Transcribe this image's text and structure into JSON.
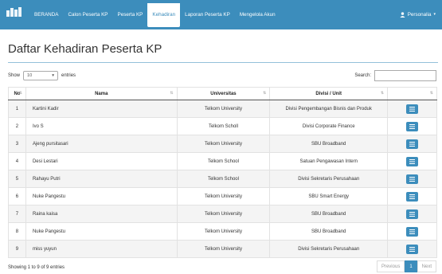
{
  "navbar": {
    "brand_icon": "brand-logo-icon",
    "items": [
      {
        "label": "BERANDA"
      },
      {
        "label": "Calon Peserta KP"
      },
      {
        "label": "Peserta KP"
      },
      {
        "label": "Kehadiran"
      },
      {
        "label": "Laporan Peserta KP"
      },
      {
        "label": "Mengelola Akun"
      }
    ],
    "active_index": 3,
    "user_label": "Personalia",
    "user_icon": "user-icon",
    "colors": {
      "bar": "#3c8dbc",
      "text": "#ffffff"
    }
  },
  "page": {
    "title": "Daftar Kehadiran Peserta KP"
  },
  "controls": {
    "show_label": "Show",
    "length_value": "10",
    "entries_label": "entries",
    "search_label": "Search:",
    "search_value": ""
  },
  "table": {
    "headers": [
      "No",
      "Nama",
      "Universitas",
      "Divisi / Unit",
      ""
    ],
    "rows": [
      {
        "no": "1",
        "nama": "Kartini Kadir",
        "universitas": "Telkom University",
        "divisi": "Divisi Pengembangan Bisnis dan Produk"
      },
      {
        "no": "2",
        "nama": "Ivo S",
        "universitas": "Telkom Scholl",
        "divisi": "Divisi Corporate Finance"
      },
      {
        "no": "3",
        "nama": "Ajeng pursitasari",
        "universitas": "Telkom University",
        "divisi": "SBU Broadband"
      },
      {
        "no": "4",
        "nama": "Desi Lestari",
        "universitas": "Telkom School",
        "divisi": "Satuan Pengawasan Intern"
      },
      {
        "no": "5",
        "nama": "Rahayu Putri",
        "universitas": "Telkom School",
        "divisi": "Divisi Sekretaris Perusahaan"
      },
      {
        "no": "6",
        "nama": "Nuke Pangestu",
        "universitas": "Telkom University",
        "divisi": "SBU Smart Energy"
      },
      {
        "no": "7",
        "nama": "Raina kaisa",
        "universitas": "Telkom University",
        "divisi": "SBU Broadband"
      },
      {
        "no": "8",
        "nama": "Nuke Pangestu",
        "universitas": "Telkom University",
        "divisi": "SBU Broadband"
      },
      {
        "no": "9",
        "nama": "miss yuyun",
        "universitas": "Telkom University",
        "divisi": "Divisi Sekretaris Perusahaan"
      }
    ],
    "action_icon": "list-icon"
  },
  "footer": {
    "info": "Showing 1 to 9 of 9 entries",
    "prev_label": "Previous",
    "current_page": "1",
    "next_label": "Next"
  }
}
